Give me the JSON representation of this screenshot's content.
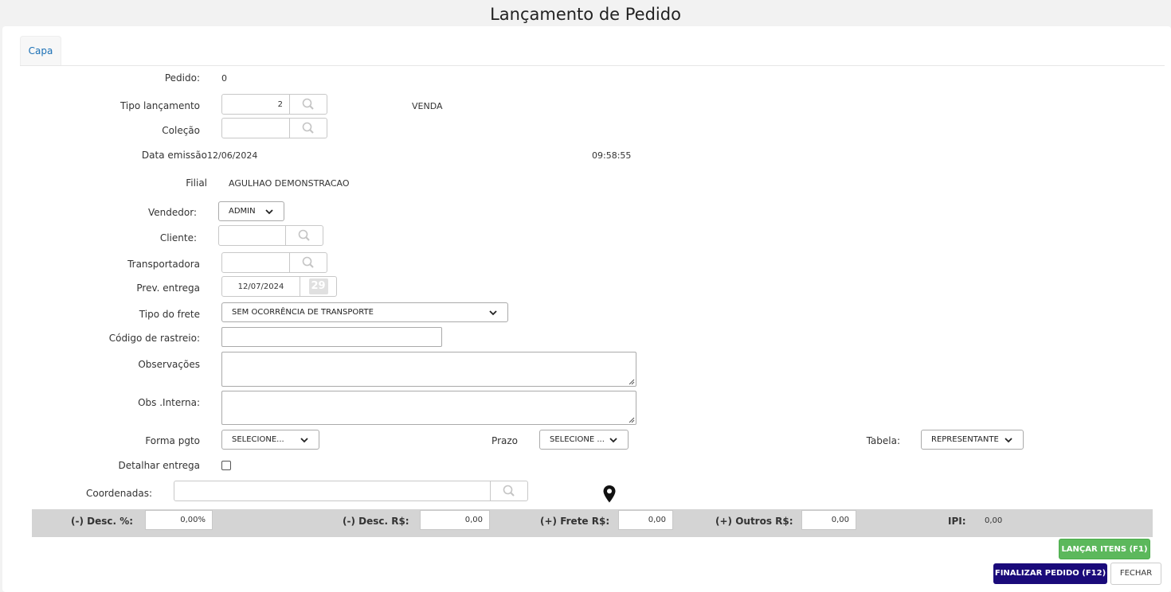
{
  "page_title": "Lançamento de Pedido",
  "tabs": [
    {
      "label": "Capa"
    }
  ],
  "pedido": {
    "label": "Pedido:",
    "value": "0"
  },
  "tipo_lancamento": {
    "label": "Tipo lançamento",
    "value": "2",
    "description": "VENDA"
  },
  "colecao": {
    "label": "Coleção",
    "value": ""
  },
  "data_emissao": {
    "label": "Data emissão",
    "date": "12/06/2024",
    "time": "09:58:55"
  },
  "filial": {
    "label": "Filial",
    "value": "AGULHAO DEMONSTRACAO"
  },
  "vendedor": {
    "label": "Vendedor:",
    "selected": "ADMIN"
  },
  "cliente": {
    "label": "Cliente:",
    "value": ""
  },
  "transportadora": {
    "label": "Transportadora",
    "value": ""
  },
  "prev_entrega": {
    "label": "Prev. entrega",
    "value": "12/07/2024",
    "calendar_day": "29"
  },
  "tipo_frete": {
    "label": "Tipo do frete",
    "selected": "SEM OCORRÊNCIA DE TRANSPORTE"
  },
  "codigo_rastreio": {
    "label": "Código de rastreio:",
    "value": ""
  },
  "observacoes": {
    "label": "Observações",
    "value": ""
  },
  "obs_interna": {
    "label": "Obs .Interna:",
    "value": ""
  },
  "forma_pgto": {
    "label": "Forma pgto",
    "selected": "SELECIONE..."
  },
  "prazo": {
    "label": "Prazo",
    "selected": "SELECIONE ..."
  },
  "tabela": {
    "label": "Tabela:",
    "selected": "REPRESENTANTE"
  },
  "detalhar_entrega": {
    "label": "Detalhar entrega",
    "checked": false
  },
  "coordenadas": {
    "label": "Coordenadas:",
    "value": ""
  },
  "totals": {
    "desc_pct": {
      "label": "(-) Desc. %:",
      "value": "0,00%"
    },
    "desc_rs": {
      "label": "(-) Desc. R$:",
      "value": "0,00"
    },
    "frete_rs": {
      "label": "(+) Frete R$:",
      "value": "0,00"
    },
    "outros_rs": {
      "label": "(+) Outros R$:",
      "value": "0,00"
    },
    "ipi": {
      "label": "IPI:",
      "value": "0,00"
    }
  },
  "buttons": {
    "lancar_itens": "LANÇAR ITENS (F1)",
    "finalizar": "FINALIZAR PEDIDO (F12)",
    "fechar": "FECHAR"
  },
  "icons": {
    "lookup": "search-icon",
    "dropdown": "chevron-down-icon",
    "location": "map-pin-icon",
    "calendar": "calendar-icon"
  },
  "colors": {
    "accent_green": "#5cb85c",
    "accent_navy": "#1a0a7a",
    "tab_link": "#1a6fb5",
    "totals_bar": "#d4d4d4"
  }
}
